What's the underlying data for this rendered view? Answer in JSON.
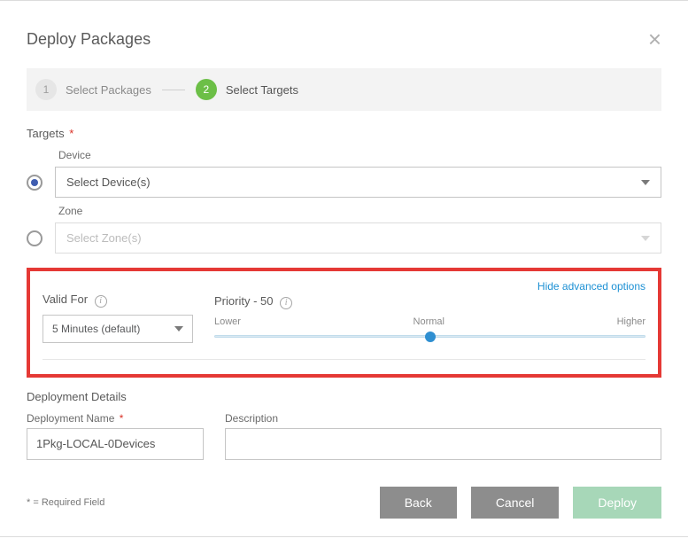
{
  "header": {
    "title": "Deploy Packages"
  },
  "steps": {
    "step1_num": "1",
    "step1_label": "Select Packages",
    "step2_num": "2",
    "step2_label": "Select Targets"
  },
  "targets": {
    "section_label": "Targets",
    "device_label": "Device",
    "device_placeholder": "Select Device(s)",
    "zone_label": "Zone",
    "zone_placeholder": "Select Zone(s)"
  },
  "advanced": {
    "toggle_label": "Hide advanced options",
    "valid_for_label": "Valid For",
    "valid_for_value": "5 Minutes (default)",
    "priority_label": "Priority",
    "priority_value": "- 50",
    "slider": {
      "lower": "Lower",
      "normal": "Normal",
      "higher": "Higher"
    }
  },
  "details": {
    "section_label": "Deployment Details",
    "name_label": "Deployment Name",
    "name_value": "1Pkg-LOCAL-0Devices",
    "desc_label": "Description",
    "desc_value": ""
  },
  "footer": {
    "required_note": "* = Required Field",
    "back": "Back",
    "cancel": "Cancel",
    "deploy": "Deploy"
  },
  "asterisk": "*"
}
